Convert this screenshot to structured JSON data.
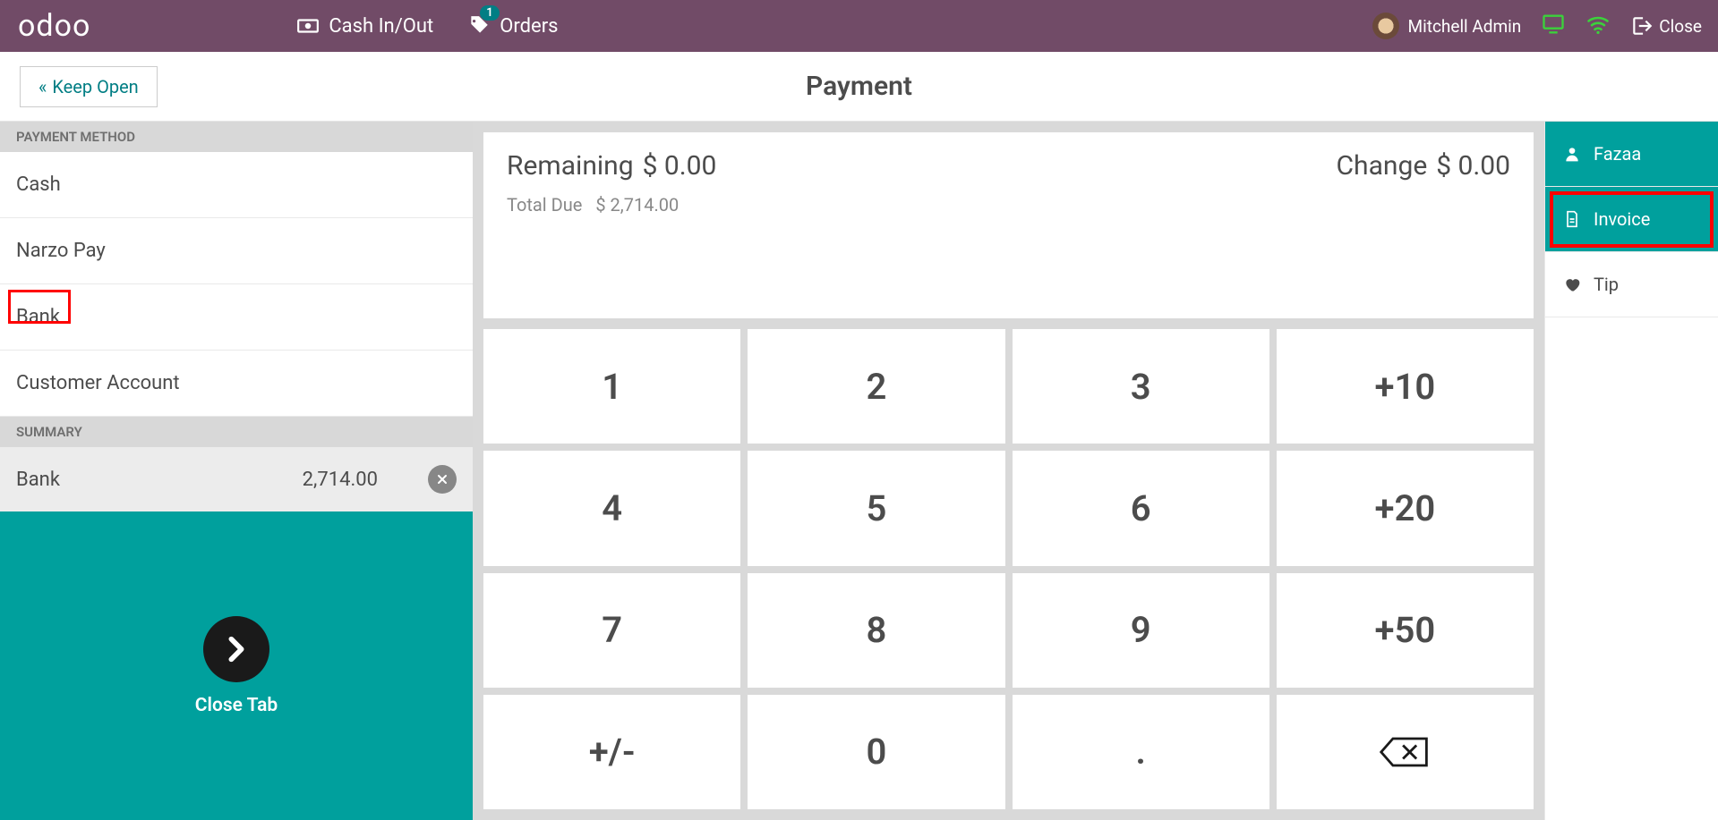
{
  "brand": "odoo",
  "topbar": {
    "cash": "Cash In/Out",
    "orders": "Orders",
    "orders_badge": "1",
    "user": "Mitchell Admin",
    "close": "Close"
  },
  "subheader": {
    "keep_open": "Keep Open",
    "title": "Payment"
  },
  "payment_methods": {
    "header": "PAYMENT METHOD",
    "items": [
      "Cash",
      "Narzo Pay",
      "Bank",
      "Customer Account"
    ]
  },
  "summary": {
    "header": "SUMMARY",
    "label": "Bank",
    "amount": "2,714.00"
  },
  "validate": {
    "label": "Close Tab"
  },
  "amounts": {
    "remaining_label": "Remaining",
    "remaining_value": "$ 0.00",
    "change_label": "Change",
    "change_value": "$ 0.00",
    "total_due_label": "Total Due",
    "total_due_value": "$ 2,714.00"
  },
  "numpad": {
    "k1": "1",
    "k2": "2",
    "k3": "3",
    "kp10": "+10",
    "k4": "4",
    "k5": "5",
    "k6": "6",
    "kp20": "+20",
    "k7": "7",
    "k8": "8",
    "k9": "9",
    "kp50": "+50",
    "ksign": "+/-",
    "k0": "0",
    "kdot": "."
  },
  "right": {
    "customer": "Fazaa",
    "invoice": "Invoice",
    "tip": "Tip"
  }
}
